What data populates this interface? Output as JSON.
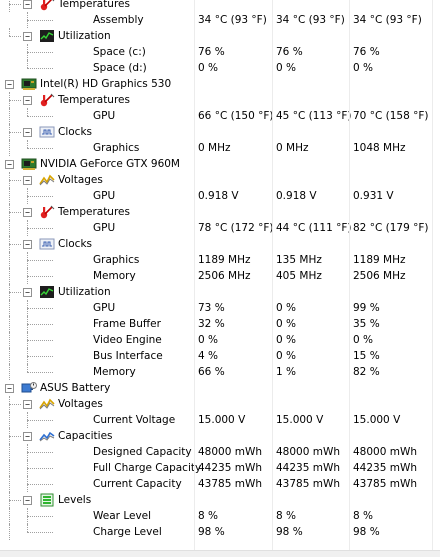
{
  "columns": [
    "value",
    "min",
    "max"
  ],
  "rows": [
    {
      "depth": 1,
      "type": "group",
      "icon": "temperature-icon",
      "label": "Temperatures",
      "toggle": "−",
      "cont": [
        false
      ],
      "last": false
    },
    {
      "depth": 2,
      "type": "leaf",
      "label": "Assembly",
      "values": [
        "34 °C  (93 °F)",
        "34 °C  (93 °F)",
        "34 °C  (93 °F)"
      ],
      "cont": [
        false,
        true
      ],
      "last": true
    },
    {
      "depth": 1,
      "type": "group",
      "icon": "utilization-icon",
      "label": "Utilization",
      "toggle": "−",
      "cont": [
        false
      ],
      "last": true
    },
    {
      "depth": 2,
      "type": "leaf",
      "label": "Space (c:)",
      "values": [
        "76 %",
        "76 %",
        "76 %"
      ],
      "cont": [
        false,
        false
      ],
      "last": false
    },
    {
      "depth": 2,
      "type": "leaf",
      "label": "Space (d:)",
      "values": [
        "0 %",
        "0 %",
        "0 %"
      ],
      "cont": [
        false,
        false
      ],
      "last": true
    },
    {
      "depth": 0,
      "type": "device",
      "icon": "gpu-card-icon",
      "label": "Intel(R) HD Graphics 530",
      "toggle": "−",
      "cont": [],
      "last": false
    },
    {
      "depth": 1,
      "type": "group",
      "icon": "temperature-icon",
      "label": "Temperatures",
      "toggle": "−",
      "cont": [
        true
      ],
      "last": false
    },
    {
      "depth": 2,
      "type": "leaf",
      "label": "GPU",
      "values": [
        "66 °C  (150 °F)",
        "45 °C  (113 °F)",
        "70 °C  (158 °F)"
      ],
      "cont": [
        true,
        false
      ],
      "last": true
    },
    {
      "depth": 1,
      "type": "group",
      "icon": "clocks-icon",
      "label": "Clocks",
      "toggle": "−",
      "cont": [
        true
      ],
      "last": true
    },
    {
      "depth": 2,
      "type": "leaf",
      "label": "Graphics",
      "values": [
        "0 MHz",
        "0 MHz",
        "1048 MHz"
      ],
      "cont": [
        true,
        false
      ],
      "last": true
    },
    {
      "depth": 0,
      "type": "device",
      "icon": "gpu-card-icon",
      "label": "NVIDIA GeForce GTX 960M",
      "toggle": "−",
      "cont": [],
      "last": false
    },
    {
      "depth": 1,
      "type": "group",
      "icon": "voltage-icon",
      "label": "Voltages",
      "toggle": "−",
      "cont": [
        true
      ],
      "last": false
    },
    {
      "depth": 2,
      "type": "leaf",
      "label": "GPU",
      "values": [
        "0.918 V",
        "0.918 V",
        "0.931 V"
      ],
      "cont": [
        true,
        true
      ],
      "last": true
    },
    {
      "depth": 1,
      "type": "group",
      "icon": "temperature-icon",
      "label": "Temperatures",
      "toggle": "−",
      "cont": [
        true
      ],
      "last": false
    },
    {
      "depth": 2,
      "type": "leaf",
      "label": "GPU",
      "values": [
        "78 °C  (172 °F)",
        "44 °C  (111 °F)",
        "82 °C  (179 °F)"
      ],
      "cont": [
        true,
        true
      ],
      "last": true
    },
    {
      "depth": 1,
      "type": "group",
      "icon": "clocks-icon",
      "label": "Clocks",
      "toggle": "−",
      "cont": [
        true
      ],
      "last": false
    },
    {
      "depth": 2,
      "type": "leaf",
      "label": "Graphics",
      "values": [
        "1189 MHz",
        "135 MHz",
        "1189 MHz"
      ],
      "cont": [
        true,
        true
      ],
      "last": false
    },
    {
      "depth": 2,
      "type": "leaf",
      "label": "Memory",
      "values": [
        "2506 MHz",
        "405 MHz",
        "2506 MHz"
      ],
      "cont": [
        true,
        true
      ],
      "last": true
    },
    {
      "depth": 1,
      "type": "group",
      "icon": "utilization-icon",
      "label": "Utilization",
      "toggle": "−",
      "cont": [
        true
      ],
      "last": true
    },
    {
      "depth": 2,
      "type": "leaf",
      "label": "GPU",
      "values": [
        "73 %",
        "0 %",
        "99 %"
      ],
      "cont": [
        true,
        false
      ],
      "last": false
    },
    {
      "depth": 2,
      "type": "leaf",
      "label": "Frame Buffer",
      "values": [
        "32 %",
        "0 %",
        "35 %"
      ],
      "cont": [
        true,
        false
      ],
      "last": false
    },
    {
      "depth": 2,
      "type": "leaf",
      "label": "Video Engine",
      "values": [
        "0 %",
        "0 %",
        "0 %"
      ],
      "cont": [
        true,
        false
      ],
      "last": false
    },
    {
      "depth": 2,
      "type": "leaf",
      "label": "Bus Interface",
      "values": [
        "4 %",
        "0 %",
        "15 %"
      ],
      "cont": [
        true,
        false
      ],
      "last": false
    },
    {
      "depth": 2,
      "type": "leaf",
      "label": "Memory",
      "values": [
        "66 %",
        "1 %",
        "82 %"
      ],
      "cont": [
        true,
        false
      ],
      "last": true
    },
    {
      "depth": 0,
      "type": "device",
      "icon": "battery-icon",
      "label": "ASUS Battery",
      "toggle": "−",
      "cont": [],
      "last": false
    },
    {
      "depth": 1,
      "type": "group",
      "icon": "voltage-icon",
      "label": "Voltages",
      "toggle": "−",
      "cont": [
        true
      ],
      "last": false
    },
    {
      "depth": 2,
      "type": "leaf",
      "label": "Current Voltage",
      "values": [
        "15.000 V",
        "15.000 V",
        "15.000 V"
      ],
      "cont": [
        true,
        true
      ],
      "last": true
    },
    {
      "depth": 1,
      "type": "group",
      "icon": "capacities-icon",
      "label": "Capacities",
      "toggle": "−",
      "cont": [
        true
      ],
      "last": false
    },
    {
      "depth": 2,
      "type": "leaf",
      "label": "Designed Capacity",
      "values": [
        "48000 mWh",
        "48000 mWh",
        "48000 mWh"
      ],
      "cont": [
        true,
        true
      ],
      "last": false
    },
    {
      "depth": 2,
      "type": "leaf",
      "label": "Full Charge Capacity",
      "values": [
        "44235 mWh",
        "44235 mWh",
        "44235 mWh"
      ],
      "cont": [
        true,
        true
      ],
      "last": false
    },
    {
      "depth": 2,
      "type": "leaf",
      "label": "Current Capacity",
      "values": [
        "43785 mWh",
        "43785 mWh",
        "43785 mWh"
      ],
      "cont": [
        true,
        true
      ],
      "last": true
    },
    {
      "depth": 1,
      "type": "group",
      "icon": "levels-icon",
      "label": "Levels",
      "toggle": "−",
      "cont": [
        true
      ],
      "last": true
    },
    {
      "depth": 2,
      "type": "leaf",
      "label": "Wear Level",
      "values": [
        "8 %",
        "8 %",
        "8 %"
      ],
      "cont": [
        true,
        false
      ],
      "last": false
    },
    {
      "depth": 2,
      "type": "leaf",
      "label": "Charge Level",
      "values": [
        "98 %",
        "98 %",
        "98 %"
      ],
      "cont": [
        true,
        false
      ],
      "last": true
    }
  ]
}
